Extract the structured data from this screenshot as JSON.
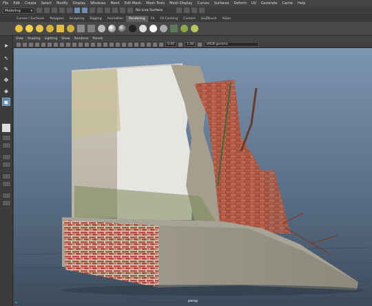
{
  "menubar": [
    "File",
    "Edit",
    "Create",
    "Select",
    "Modify",
    "Display",
    "Windows",
    "Mesh",
    "Edit Mesh",
    "Mesh Tools",
    "Mesh Display",
    "Curves",
    "Surfaces",
    "Deform",
    "UV",
    "Generate",
    "Cache",
    "Help"
  ],
  "status": {
    "mode": "Modeling",
    "no_live_surface": "No Live Surface"
  },
  "shelf_tabs": [
    "Curves / Surfaces",
    "Polygons",
    "Sculpting",
    "Rigging",
    "Animation",
    "Rendering",
    "FX",
    "FX Caching",
    "Custom",
    "GoZBrush",
    "XGen"
  ],
  "active_tab": "Rendering",
  "panel_menu": [
    "View",
    "Shading",
    "Lighting",
    "Show",
    "Renderer",
    "Panels"
  ],
  "panel_toolbar": {
    "exposure": "0.00",
    "gamma": "1.00",
    "color_space": "sRGB gamma"
  },
  "viewport": {
    "camera": "persp"
  },
  "colors": {
    "accent": "#5285a6",
    "bg_top": "#7c95b0",
    "bg_bottom": "#3d4c5c"
  }
}
